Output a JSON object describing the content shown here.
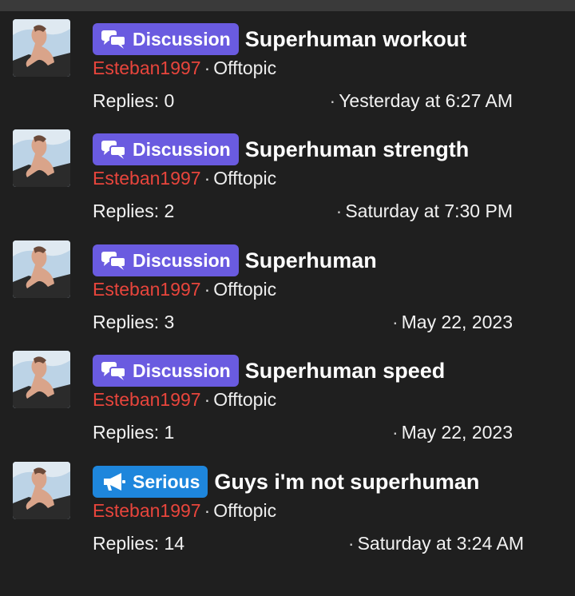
{
  "threads": [
    {
      "prefix": "Discussion",
      "prefix_type": "discussion",
      "prefix_icon": "chat-bubbles-icon",
      "title": "Superhuman workout",
      "author": "Esteban1997",
      "separator": "·",
      "forum": "Offtopic",
      "replies": "Replies: 0",
      "date": "Yesterday at 6:27 AM"
    },
    {
      "prefix": "Discussion",
      "prefix_type": "discussion",
      "prefix_icon": "chat-bubbles-icon",
      "title": "Superhuman strength",
      "author": "Esteban1997",
      "separator": "·",
      "forum": "Offtopic",
      "replies": "Replies: 2",
      "date": "Saturday at 7:30 PM"
    },
    {
      "prefix": "Discussion",
      "prefix_type": "discussion",
      "prefix_icon": "chat-bubbles-icon",
      "title": "Superhuman",
      "author": "Esteban1997",
      "separator": "·",
      "forum": "Offtopic",
      "replies": "Replies: 3",
      "date": "May 22, 2023"
    },
    {
      "prefix": "Discussion",
      "prefix_type": "discussion",
      "prefix_icon": "chat-bubbles-icon",
      "title": "Superhuman speed",
      "author": "Esteban1997",
      "separator": "·",
      "forum": "Offtopic",
      "replies": "Replies: 1",
      "date": "May 22, 2023"
    },
    {
      "prefix": "Serious",
      "prefix_type": "serious",
      "prefix_icon": "megaphone-icon",
      "title": "Guys i'm not superhuman",
      "author": "Esteban1997",
      "separator": "·",
      "forum": "Offtopic",
      "replies": "Replies: 14",
      "date": "Saturday at 3:24 AM"
    }
  ],
  "colors": {
    "background": "#1f1f1f",
    "discussion_badge": "#6a5be0",
    "serious_badge": "#1e86dc",
    "author": "#e8453c"
  }
}
